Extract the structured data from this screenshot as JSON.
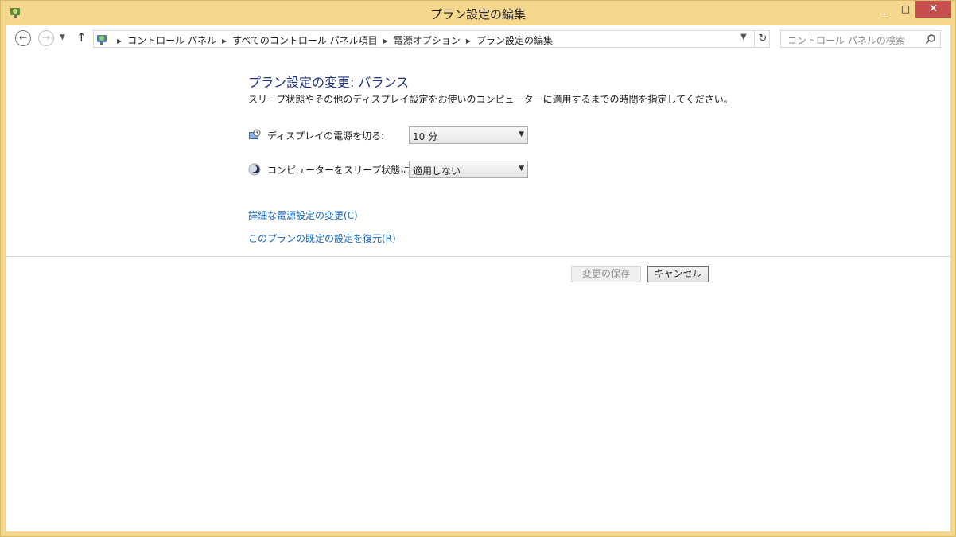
{
  "window": {
    "title": "プラン設定の編集",
    "app_icon": "power-options-icon",
    "minimize_glyph": "_",
    "maximize_glyph": "□",
    "close_glyph": "✕"
  },
  "nav": {
    "back_glyph": "←",
    "forward_glyph": "→",
    "recent_glyph": "▼",
    "up_glyph": "↑"
  },
  "address": {
    "crumbs": [
      "コントロール パネル",
      "すべてのコントロール パネル項目",
      "電源オプション",
      "プラン設定の編集"
    ],
    "separator": "▶",
    "dropdown_glyph": "▼",
    "refresh_glyph": "↻"
  },
  "search": {
    "placeholder": "コントロール パネルの検索"
  },
  "main": {
    "heading": "プラン設定の変更: バランス",
    "description": "スリープ状態やその他のディスプレイ設定をお使いのコンピューターに適用するまでの時間を指定してください。",
    "display_off": {
      "label": "ディスプレイの電源を切る:",
      "value": "10 分",
      "icon": "monitor-clock-icon"
    },
    "sleep": {
      "label": "コンピューターをスリープ状態にする:",
      "value": "適用しない",
      "icon": "moon-icon"
    },
    "advanced_link": "詳細な電源設定の変更(C)",
    "restore_link": "このプランの既定の設定を復元(R)",
    "save_button": "変更の保存",
    "cancel_button": "キャンセル"
  },
  "colors": {
    "frame": "#f5d88e",
    "close_button": "#c7504f",
    "heading": "#1e3287",
    "link": "#1565c0"
  }
}
